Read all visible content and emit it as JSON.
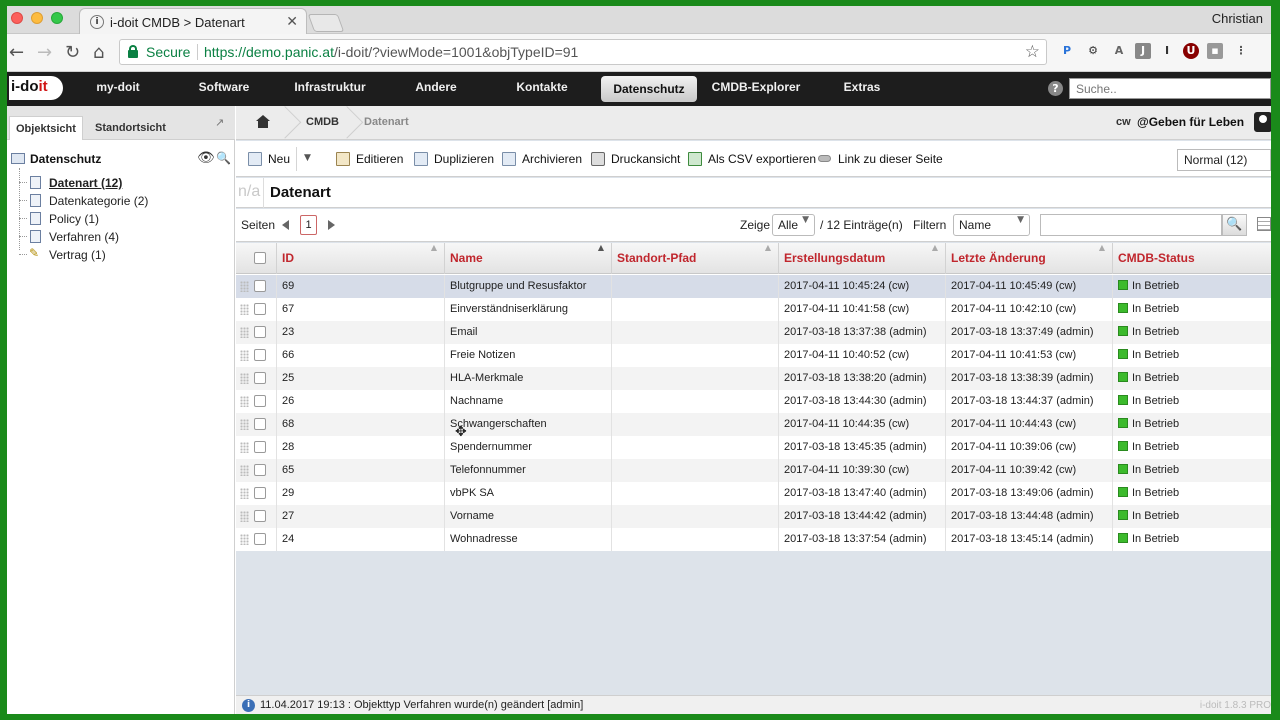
{
  "browser": {
    "tab_title": "i-doit CMDB > Datenart",
    "profile_name": "Christian",
    "secure_label": "Secure",
    "url_prefix": "https://demo.panic.at",
    "url_rest": "/i-doit/?viewMode=1001&objTypeID=91"
  },
  "topnav": {
    "logo_prefix": "i-do",
    "logo_suffix": "it",
    "items": [
      "my-doit",
      "Software",
      "Infrastruktur",
      "Andere",
      "Kontakte",
      "Datenschutz",
      "CMDB-Explorer",
      "Extras"
    ],
    "active_item": "Datenschutz",
    "search_placeholder": "Suche.."
  },
  "sidebar": {
    "tabs": [
      "Objektsicht",
      "Standortsicht"
    ],
    "active_tab": "Objektsicht",
    "root": "Datenschutz",
    "items": [
      {
        "label": "Datenart (12)",
        "selected": true,
        "icon": "document-icon"
      },
      {
        "label": "Datenkategorie (2)",
        "selected": false,
        "icon": "document-icon"
      },
      {
        "label": "Policy (1)",
        "selected": false,
        "icon": "document-icon"
      },
      {
        "label": "Verfahren (4)",
        "selected": false,
        "icon": "document-icon"
      },
      {
        "label": "Vertrag (1)",
        "selected": false,
        "icon": "pen-icon"
      }
    ]
  },
  "breadcrumb": {
    "items": [
      "CMDB",
      "Datenart"
    ],
    "user_short": "cw",
    "user_org": "@Geben für Leben"
  },
  "toolbar": {
    "new": "Neu",
    "edit": "Editieren",
    "duplicate": "Duplizieren",
    "archive": "Archivieren",
    "print": "Druckansicht",
    "csv": "Als CSV exportieren",
    "link": "Link zu dieser Seite",
    "view_mode": "Normal (12)"
  },
  "page": {
    "na": "n/a",
    "title": "Datenart"
  },
  "pager": {
    "pages_label": "Seiten",
    "current_page": "1",
    "show_label": "Zeige",
    "show_value": "Alle",
    "count_text": "/ 12 Einträge(n)",
    "filter_label": "Filtern",
    "filter_field": "Name"
  },
  "table": {
    "columns": [
      "ID",
      "Name",
      "Standort-Pfad",
      "Erstellungsdatum",
      "Letzte Änderung",
      "CMDB-Status"
    ],
    "sorted_column": "Name",
    "rows": [
      {
        "id": "69",
        "name": "Blutgruppe und Resusfaktor",
        "path": "",
        "created": "2017-04-11 10:45:24 (cw)",
        "changed": "2017-04-11 10:45:49 (cw)",
        "status": "In Betrieb"
      },
      {
        "id": "67",
        "name": "Einverständniserklärung",
        "path": "",
        "created": "2017-04-11 10:41:58 (cw)",
        "changed": "2017-04-11 10:42:10 (cw)",
        "status": "In Betrieb"
      },
      {
        "id": "23",
        "name": "Email",
        "path": "",
        "created": "2017-03-18 13:37:38 (admin)",
        "changed": "2017-03-18 13:37:49 (admin)",
        "status": "In Betrieb"
      },
      {
        "id": "66",
        "name": "Freie Notizen",
        "path": "",
        "created": "2017-04-11 10:40:52 (cw)",
        "changed": "2017-04-11 10:41:53 (cw)",
        "status": "In Betrieb"
      },
      {
        "id": "25",
        "name": "HLA-Merkmale",
        "path": "",
        "created": "2017-03-18 13:38:20 (admin)",
        "changed": "2017-03-18 13:38:39 (admin)",
        "status": "In Betrieb"
      },
      {
        "id": "26",
        "name": "Nachname",
        "path": "",
        "created": "2017-03-18 13:44:30 (admin)",
        "changed": "2017-03-18 13:44:37 (admin)",
        "status": "In Betrieb"
      },
      {
        "id": "68",
        "name": "Schwangerschaften",
        "path": "",
        "created": "2017-04-11 10:44:35 (cw)",
        "changed": "2017-04-11 10:44:43 (cw)",
        "status": "In Betrieb"
      },
      {
        "id": "28",
        "name": "Spendernummer",
        "path": "",
        "created": "2017-03-18 13:45:35 (admin)",
        "changed": "2017-04-11 10:39:06 (cw)",
        "status": "In Betrieb"
      },
      {
        "id": "65",
        "name": "Telefonnummer",
        "path": "",
        "created": "2017-04-11 10:39:30 (cw)",
        "changed": "2017-04-11 10:39:42 (cw)",
        "status": "In Betrieb"
      },
      {
        "id": "29",
        "name": "vbPK SA",
        "path": "",
        "created": "2017-03-18 13:47:40 (admin)",
        "changed": "2017-03-18 13:49:06 (admin)",
        "status": "In Betrieb"
      },
      {
        "id": "27",
        "name": "Vorname",
        "path": "",
        "created": "2017-03-18 13:44:42 (admin)",
        "changed": "2017-03-18 13:44:48 (admin)",
        "status": "In Betrieb"
      },
      {
        "id": "24",
        "name": "Wohnadresse",
        "path": "",
        "created": "2017-03-18 13:37:54 (admin)",
        "changed": "2017-03-18 13:45:14 (admin)",
        "status": "In Betrieb"
      }
    ],
    "status_color": "#3cba2c"
  },
  "statusbar": {
    "message": "11.04.2017 19:13 : Objekttyp Verfahren wurde(n) geändert [admin]",
    "version": "i-doit 1.8.3 PRO"
  }
}
